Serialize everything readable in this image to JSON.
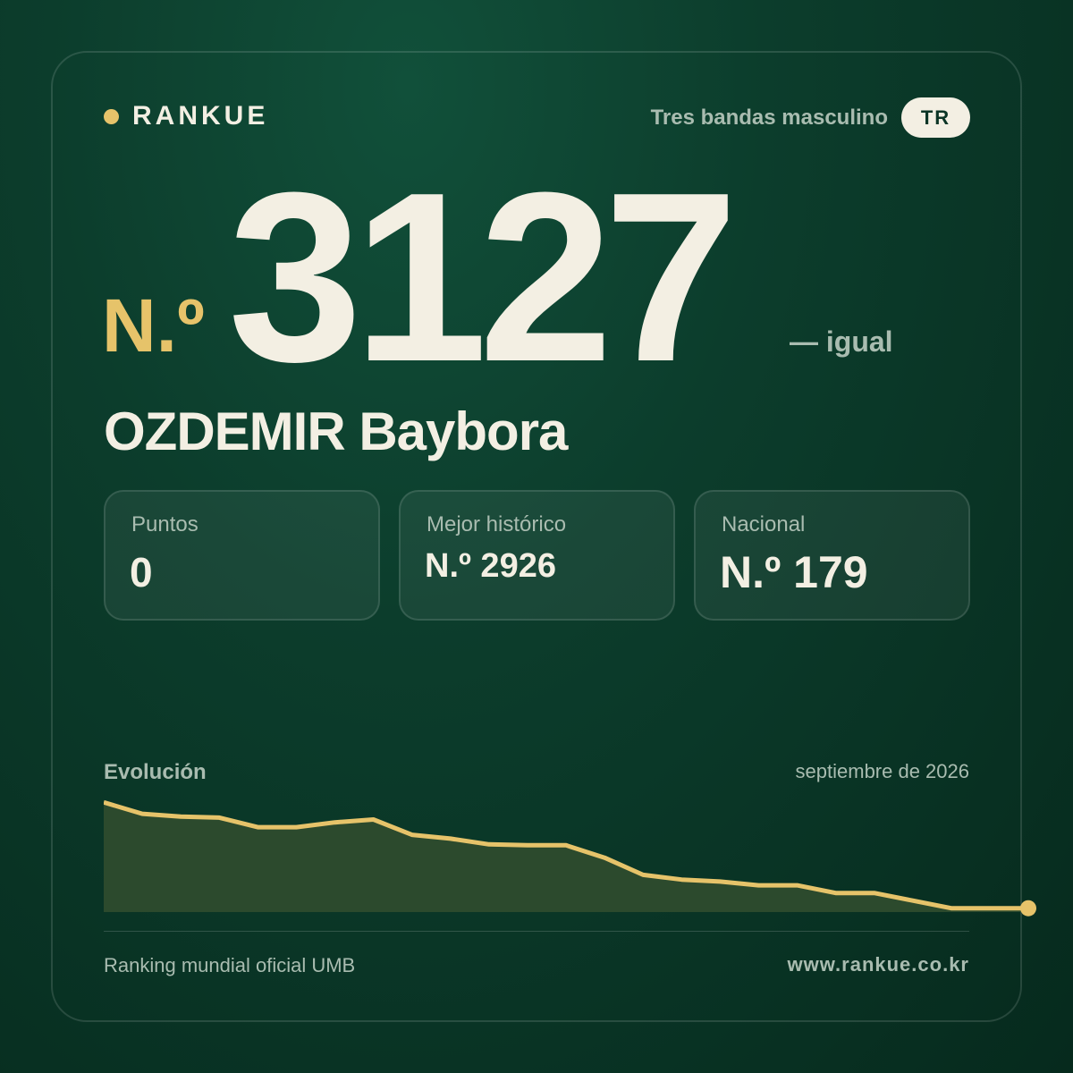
{
  "brand": {
    "name": "RANKUE"
  },
  "header": {
    "category": "Tres bandas masculino",
    "country_code": "TR"
  },
  "rank": {
    "prefix": "N.º",
    "number": "3127",
    "change": "— igual"
  },
  "player": {
    "name": "OZDEMIR Baybora"
  },
  "stats": [
    {
      "label": "Puntos",
      "value": "0"
    },
    {
      "label": "Mejor histórico",
      "value": "N.º 2926"
    },
    {
      "label": "Nacional",
      "value": "N.º 179"
    }
  ],
  "evolution": {
    "title": "Evolución",
    "date": "septiembre de 2026"
  },
  "chart_data": {
    "type": "area",
    "title": "",
    "values": [
      5,
      17,
      20,
      21,
      31,
      31,
      26,
      23,
      39,
      43,
      49,
      50,
      50,
      63,
      81,
      86,
      88,
      92,
      92,
      100,
      100,
      108,
      116,
      116,
      116
    ],
    "line_color": "#e6c36a",
    "fill_color": "#2c4a2d"
  },
  "footer": {
    "source": "Ranking mundial oficial UMB",
    "website": "www.rankue.co.kr"
  },
  "colors": {
    "accent": "#e6c36a",
    "background": "#0c3d2c",
    "text": "#f3efe3",
    "muted": "#a9bcb0"
  }
}
